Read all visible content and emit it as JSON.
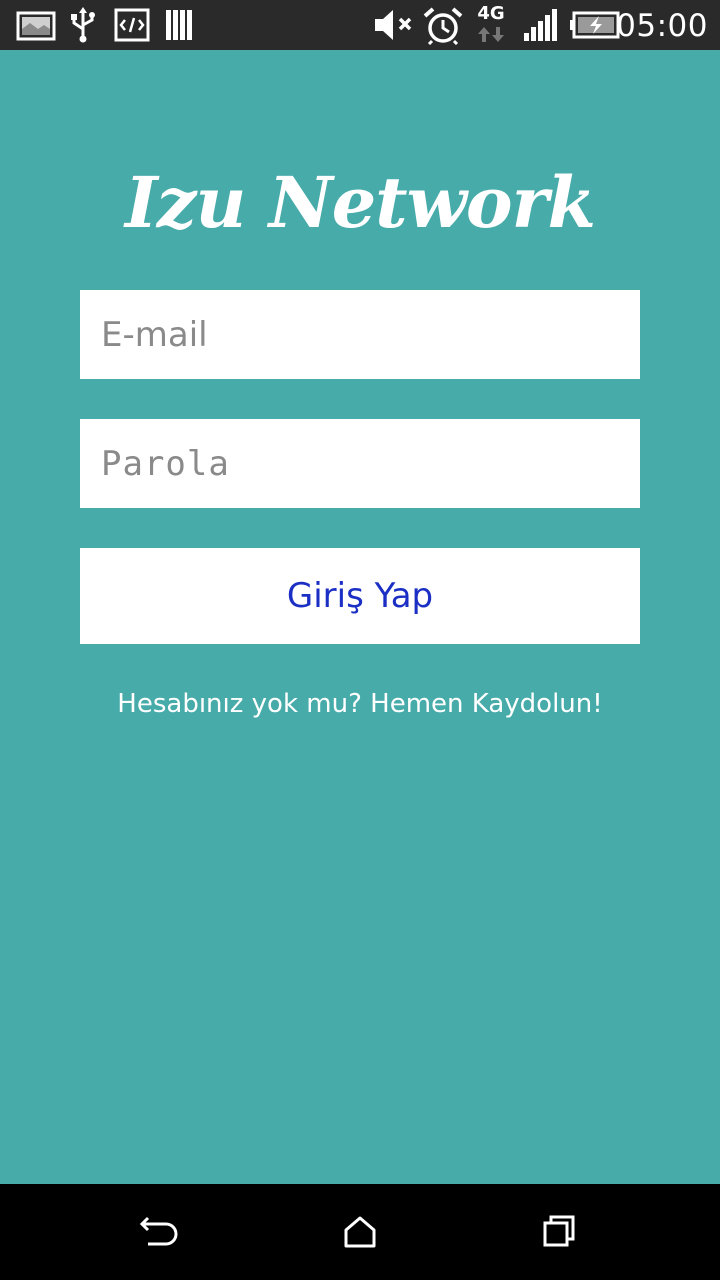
{
  "status_bar": {
    "time": "05:00",
    "network_type": "4G",
    "left_icons": [
      "image-icon",
      "usb-icon",
      "developer-icon",
      "notes-icon"
    ],
    "right_icons": [
      "muted-speaker-icon",
      "alarm-icon",
      "network-4g-icon",
      "signal-icon",
      "battery-icon"
    ]
  },
  "app": {
    "title": "Izu Network"
  },
  "login_form": {
    "email_placeholder": "E-mail",
    "email_value": "",
    "password_placeholder": "Parola",
    "password_value": "",
    "submit_label": "Giriş Yap",
    "register_prompt": "Hesabınız yok mu? Hemen Kaydolun!"
  },
  "nav_bar": {
    "buttons": [
      "back-icon",
      "home-icon",
      "recents-icon"
    ]
  },
  "colors": {
    "background": "#47ABAA",
    "status_bar": "#2a2a2a",
    "button_text": "#1b2fc5",
    "field_background": "#ffffff"
  }
}
